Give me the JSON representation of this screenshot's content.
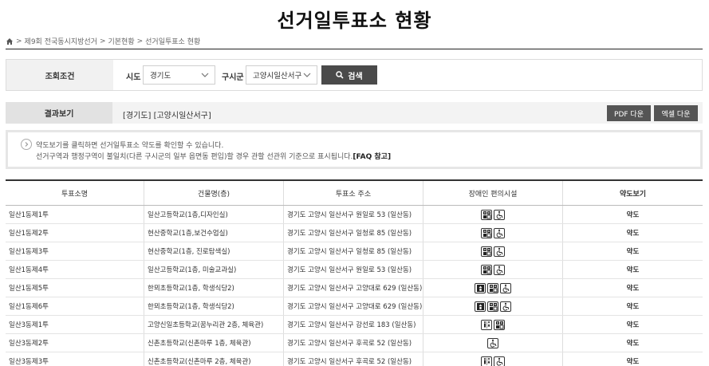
{
  "page": {
    "title": "선거일투표소 현황"
  },
  "breadcrumb": {
    "items": [
      "제9회 전국동시지방선거",
      "기본현황",
      "선거일투표소 현황"
    ],
    "sep": ">"
  },
  "search": {
    "section_label": "조회조건",
    "sido_label": "시도",
    "sido_value": "경기도",
    "gusigun_label": "구시군",
    "gusigun_value": "고양시일산서구",
    "button_label": "검색"
  },
  "result": {
    "section_label": "결과보기",
    "text": "[경기도] [고양시일산서구]",
    "pdf_label": "PDF 다운",
    "excel_label": "엑셀 다운"
  },
  "notice": {
    "line1": "약도보기를 클릭하면 선거일투표소 약도를 확인할 수 있습니다.",
    "line2": "선거구역과 행정구역이 불일치(다른 구시군의 일부 읍면동 편입)할 경우 관할 선관위 기준으로 표시됩니다.",
    "faq": "[FAQ 참고]"
  },
  "table": {
    "headers": [
      "투표소명",
      "건물명(층)",
      "투표소 주소",
      "장애인 편의시설",
      "약도보기"
    ],
    "rows": [
      {
        "name": "일산1동제1투",
        "building": "일산고등학교(1층,디자인실)",
        "address": "경기도 고양시 일산서구 원일로 53 (일산동)",
        "facilities": [
          "ramp-icon",
          "wheelchair-icon"
        ],
        "map": "약도"
      },
      {
        "name": "일산1동제2투",
        "building": "현산중학교(1층,보건수업실)",
        "address": "경기도 고양시 일산서구 일청로 85 (일산동)",
        "facilities": [
          "ramp-icon",
          "wheelchair-icon"
        ],
        "map": "약도"
      },
      {
        "name": "일산1동제3투",
        "building": "현산중학교(1층, 진로탐색실)",
        "address": "경기도 고양시 일산서구 일청로 85 (일산동)",
        "facilities": [
          "ramp-icon",
          "wheelchair-icon"
        ],
        "map": "약도"
      },
      {
        "name": "일산1동제4투",
        "building": "일산고등학교(1층, 미술교과실)",
        "address": "경기도 고양시 일산서구 원일로 53 (일산동)",
        "facilities": [
          "ramp-icon",
          "wheelchair-icon"
        ],
        "map": "약도"
      },
      {
        "name": "일산1동제5투",
        "building": "한뫼초등학교(1층, 학생식당2)",
        "address": "경기도 고양시 일산서구 고양대로 629 (일산동)",
        "facilities": [
          "elevator-icon",
          "ramp-icon",
          "wheelchair-icon"
        ],
        "map": "약도"
      },
      {
        "name": "일산1동제6투",
        "building": "한뫼초등학교(1층, 학생식당2)",
        "address": "경기도 고양시 일산서구 고양대로 629 (일산동)",
        "facilities": [
          "elevator-icon",
          "ramp-icon",
          "wheelchair-icon"
        ],
        "map": "약도"
      },
      {
        "name": "일산3동제1투",
        "building": "고양신일초등학교(꿈누리관 2층, 체육관)",
        "address": "경기도 고양시 일산서구 강선로 183 (일산동)",
        "facilities": [
          "restroom-icon",
          "ramp-icon"
        ],
        "map": "약도"
      },
      {
        "name": "일산3동제2투",
        "building": "신촌초등학교(신촌마루 1층, 체육관)",
        "address": "경기도 고양시 일산서구 후곡로 52 (일산동)",
        "facilities": [
          "wheelchair-icon"
        ],
        "map": "약도"
      },
      {
        "name": "일산3동제3투",
        "building": "신촌초등학교(신촌마루 2층, 체육관)",
        "address": "경기도 고양시 일산서구 후곡로 52 (일산동)",
        "facilities": [
          "restroom-icon",
          "wheelchair-icon"
        ],
        "map": "약도"
      }
    ]
  }
}
